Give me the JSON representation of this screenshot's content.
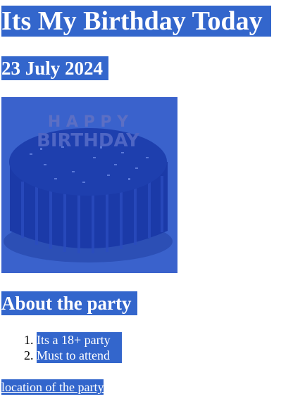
{
  "page": {
    "title": "Its My Birthday Today",
    "date": "23 July 2024",
    "cake_image": {
      "alt": "birthday-cake",
      "banner_text": "HAPPY BIRTHDAY"
    },
    "about_heading": "About the party",
    "party_items": [
      "Its a 18+ party",
      "Must to attend"
    ],
    "location_link": "location of the party"
  },
  "colors": {
    "highlight": "#3366cc",
    "text_on_highlight": "#ffffff"
  }
}
